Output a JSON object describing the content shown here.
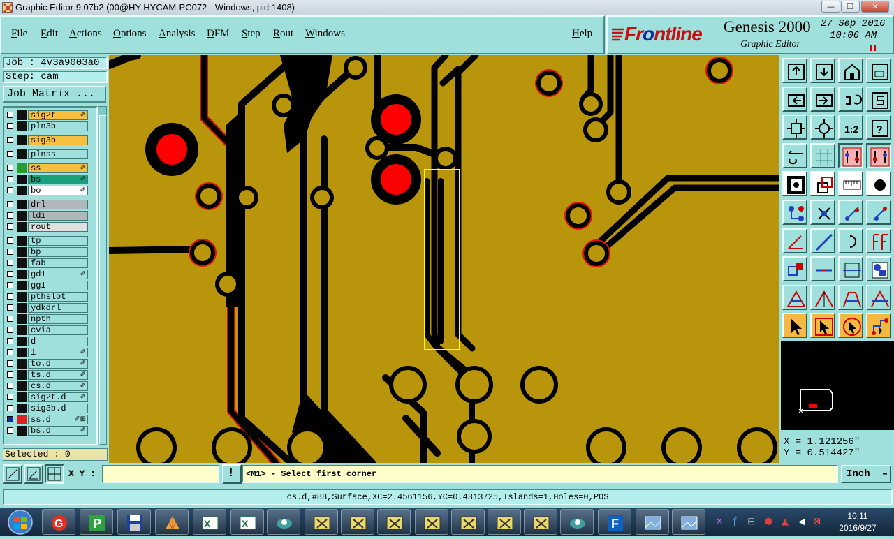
{
  "window": {
    "title": "Graphic Editor 9.07b2 (00@HY-HYCAM-PC072 - Windows, pid:1408)",
    "minimize_glyph": "—",
    "maximize_glyph": "❐",
    "close_glyph": "✕"
  },
  "menu": {
    "file": "File",
    "edit": "Edit",
    "actions": "Actions",
    "options": "Options",
    "analysis": "Analysis",
    "dfm": "DFM",
    "step": "Step",
    "rout": "Rout",
    "windows": "Windows",
    "help": "Help"
  },
  "brand": {
    "logo_part1": "Fr",
    "logo_part2": "o",
    "logo_part3": "ntline",
    "product": "Genesis 2000",
    "subtitle": "Graphic Editor",
    "date": "27 Sep 2016",
    "time": "10:06 AM"
  },
  "job": {
    "job_label": "Job : 4v3a9003a0",
    "step_label": "Step: cam",
    "matrix_button": "Job Matrix ..."
  },
  "layers": [
    {
      "name": "sig2t",
      "bg": "#f5c040",
      "swatch": "#111111",
      "mark": "✐"
    },
    {
      "name": "pln3b",
      "bg": "#9fdfdc",
      "swatch": "#111111",
      "mark": ""
    },
    {
      "name": "sig3b",
      "bg": "#f5c040",
      "swatch": "#111111",
      "mark": ""
    },
    {
      "name": "plnss",
      "bg": "#9fdfdc",
      "swatch": "#111111",
      "mark": ""
    },
    {
      "name": "ss",
      "bg": "#f5c040",
      "swatch": "#2e9a2e",
      "mark": "✐"
    },
    {
      "name": "bs",
      "bg": "#1aa07a",
      "swatch": "#111111",
      "mark": "✐"
    },
    {
      "name": "bo",
      "bg": "#ffffff",
      "swatch": "#111111",
      "mark": "✐"
    },
    {
      "name": "drl",
      "bg": "#b0b8bc",
      "swatch": "#111111",
      "mark": ""
    },
    {
      "name": "ldi",
      "bg": "#b0b8bc",
      "swatch": "#111111",
      "mark": ""
    },
    {
      "name": "rout",
      "bg": "#e0e0e0",
      "swatch": "#111111",
      "mark": ""
    },
    {
      "name": "tp",
      "bg": "#9fdfdc",
      "swatch": "#111111",
      "mark": ""
    },
    {
      "name": "bp",
      "bg": "#9fdfdc",
      "swatch": "#111111",
      "mark": ""
    },
    {
      "name": "fab",
      "bg": "#9fdfdc",
      "swatch": "#111111",
      "mark": ""
    },
    {
      "name": "gd1",
      "bg": "#9fdfdc",
      "swatch": "#111111",
      "mark": "✐"
    },
    {
      "name": "gg1",
      "bg": "#9fdfdc",
      "swatch": "#111111",
      "mark": ""
    },
    {
      "name": "pthslot",
      "bg": "#9fdfdc",
      "swatch": "#111111",
      "mark": ""
    },
    {
      "name": "ydkdrl",
      "bg": "#9fdfdc",
      "swatch": "#111111",
      "mark": ""
    },
    {
      "name": "npth",
      "bg": "#9fdfdc",
      "swatch": "#111111",
      "mark": ""
    },
    {
      "name": "cvia",
      "bg": "#9fdfdc",
      "swatch": "#111111",
      "mark": ""
    },
    {
      "name": "d",
      "bg": "#9fdfdc",
      "swatch": "#111111",
      "mark": ""
    },
    {
      "name": "1",
      "bg": "#9fdfdc",
      "swatch": "#111111",
      "mark": "✐"
    },
    {
      "name": "to.d",
      "bg": "#9fdfdc",
      "swatch": "#111111",
      "mark": "✐"
    },
    {
      "name": "ts.d",
      "bg": "#9fdfdc",
      "swatch": "#111111",
      "mark": "✐"
    },
    {
      "name": "cs.d",
      "bg": "#9fdfdc",
      "swatch": "#111111",
      "mark": "✐"
    },
    {
      "name": "sig2t.d",
      "bg": "#9fdfdc",
      "swatch": "#111111",
      "mark": "✐"
    },
    {
      "name": "sig3b.d",
      "bg": "#9fdfdc",
      "swatch": "#111111",
      "mark": ""
    },
    {
      "name": "ss.d",
      "bg": "#9fdfdc",
      "swatch": "#e02020",
      "mark": "✐⊞"
    },
    {
      "name": "bs.d",
      "bg": "#9fdfdc",
      "swatch": "#111111",
      "mark": "✐"
    }
  ],
  "selected_label": "Selected : 0",
  "coords": {
    "x": "X = 1.121256\"",
    "y": "Y = 0.514427\""
  },
  "command": {
    "xy_label": "X Y :",
    "xy_value": "",
    "warn_glyph": "!",
    "prompt": "<M1> - Select first corner",
    "units": "Inch",
    "units_glyph": "▬"
  },
  "status_line": "cs.d,#88,Surface,XC=2.4561156,YC=0.4313725,Islands=1,Holes=0,POS",
  "taskbar": {
    "time": "10:11",
    "date": "2016/9/27"
  },
  "colors": {
    "panel": "#9fdfdc",
    "board": "#b8950a",
    "trace": "#000000",
    "selection": "#ffff00",
    "pad_red": "#ff0000"
  }
}
